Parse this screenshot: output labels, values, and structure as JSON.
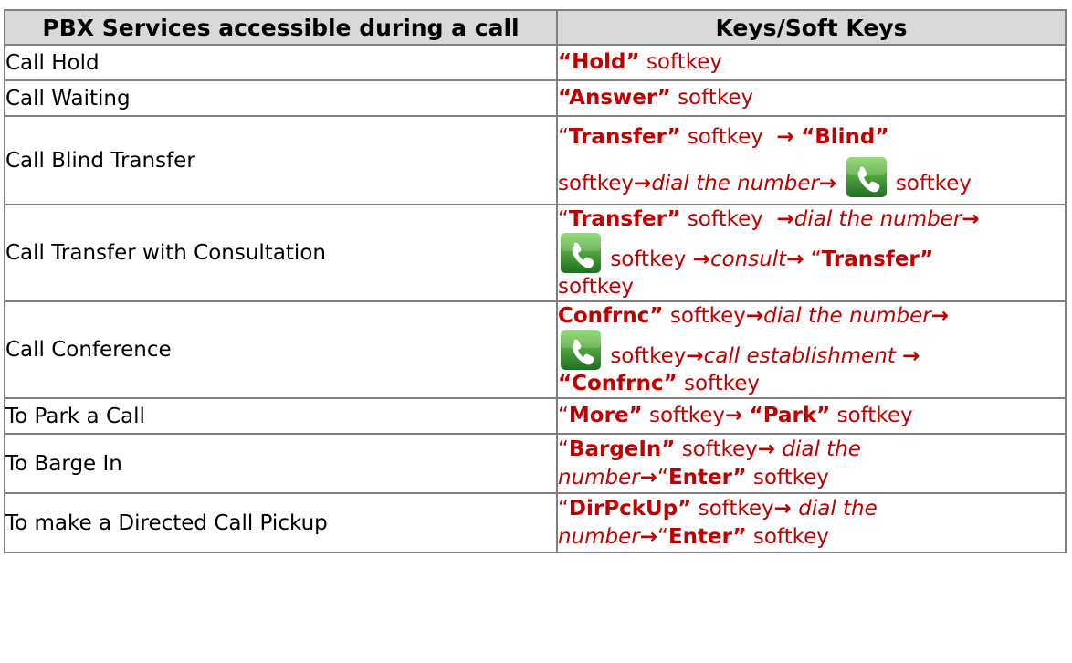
{
  "table": {
    "headers": {
      "service": "PBX Services accessible during a call",
      "keys": "Keys/Soft Keys"
    },
    "rows": [
      {
        "service": "Call Hold"
      },
      {
        "service": "Call Waiting"
      },
      {
        "service": "Call Blind Transfer"
      },
      {
        "service": "Call Transfer with Consultation"
      },
      {
        "service": "Call Conference"
      },
      {
        "service": "To Park a Call"
      },
      {
        "service": "To Barge In"
      },
      {
        "service": "To make a Directed Call Pickup"
      }
    ]
  },
  "keys": {
    "open_quote": "“",
    "close_quote": "”",
    "softkey": "softkey",
    "arrow": "→",
    "hold": "Hold",
    "answer": "Answer",
    "transfer": "Transfer",
    "blind": "Blind",
    "confrnc": "Confrnc",
    "more": "More",
    "park": "Park",
    "bargein": "BargeIn",
    "dirpckup": "DirPckUp",
    "enter": "Enter",
    "dial_the_number": "dial the number",
    "dial_the": "dial the",
    "number": "number",
    "consult": "consult",
    "call_establishment": "call establishment",
    "quoted_hold": "“Hold”",
    "quoted_answer": "“Answer”",
    "quoted_blind": "“Blind”",
    "quoted_park": "“Park”",
    "quoted_confrnc": "“Confrnc”",
    "transfer_close": "Transfer”",
    "confrnc_close": "Confrnc”",
    "more_close": "More”",
    "bargein_close": "BargeIn”",
    "dirpckup_close": "DirPckUp”",
    "enter_close": "Enter”"
  },
  "icons": {
    "phone": "phone-handset-icon",
    "phone_bg": "#2e8b2e"
  },
  "colors": {
    "key_text": "#c00000",
    "header_bg": "#d9d9d9",
    "border": "#7f7f7f"
  }
}
